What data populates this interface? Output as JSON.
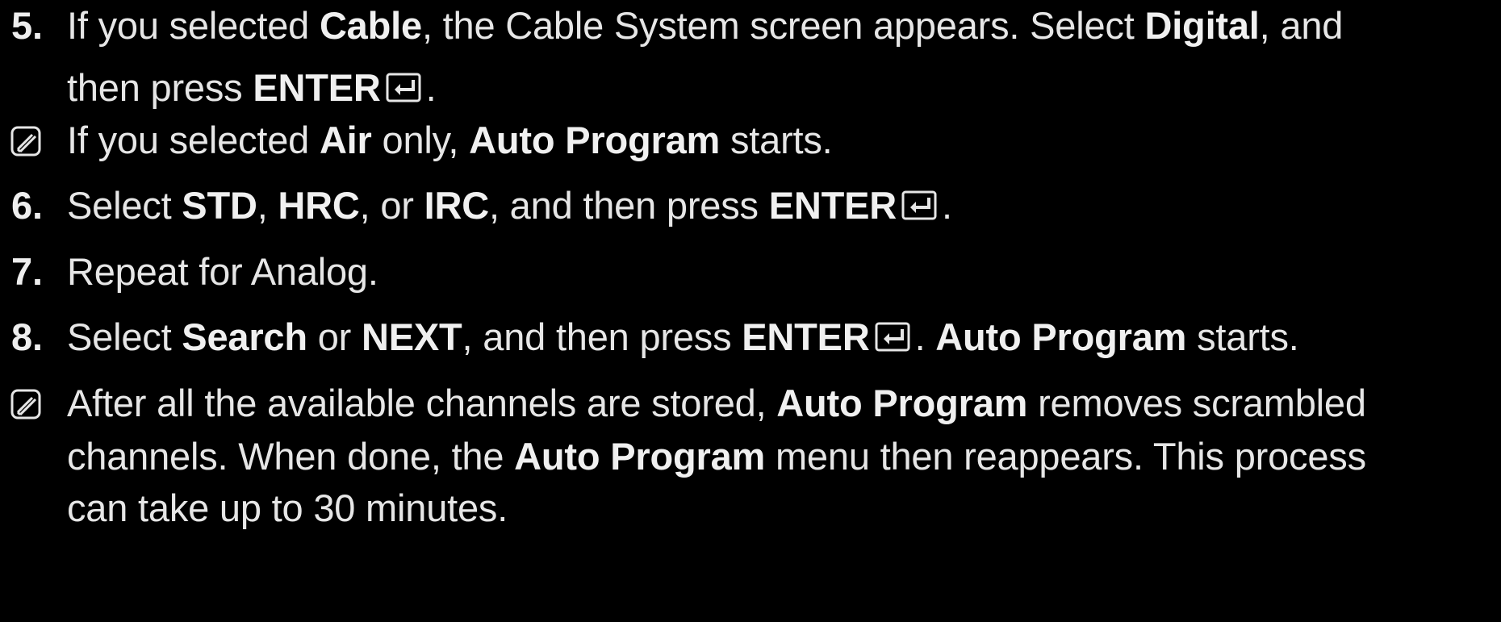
{
  "colors": {
    "background": "#000000",
    "text": "#e6e6e6"
  },
  "icons": {
    "note": "note-icon",
    "enter": "enter-key-icon"
  },
  "items": [
    {
      "type": "step",
      "number": "5.",
      "segments": [
        {
          "text": "If you selected ",
          "bold": false
        },
        {
          "text": "Cable",
          "bold": true
        },
        {
          "text": ", the Cable System screen appears. Select ",
          "bold": false
        },
        {
          "text": "Digital",
          "bold": true
        },
        {
          "text": ", and",
          "bold": false
        }
      ],
      "line2": [
        {
          "text": "then press ",
          "bold": false
        },
        {
          "text": "ENTER",
          "bold": true
        },
        {
          "text": ".",
          "bold": false
        }
      ]
    },
    {
      "type": "note",
      "segments": [
        {
          "text": "If you selected ",
          "bold": false
        },
        {
          "text": "Air",
          "bold": true
        },
        {
          "text": " only, ",
          "bold": false
        },
        {
          "text": "Auto Program",
          "bold": true
        },
        {
          "text": " starts.",
          "bold": false
        }
      ]
    },
    {
      "type": "step",
      "number": "6.",
      "segments": [
        {
          "text": "Select ",
          "bold": false
        },
        {
          "text": "STD",
          "bold": true
        },
        {
          "text": ", ",
          "bold": false
        },
        {
          "text": "HRC",
          "bold": true
        },
        {
          "text": ", or ",
          "bold": false
        },
        {
          "text": "IRC",
          "bold": true
        },
        {
          "text": ", and then press ",
          "bold": false
        },
        {
          "text": "ENTER",
          "bold": true
        },
        {
          "text": ".",
          "bold": false
        }
      ]
    },
    {
      "type": "step",
      "number": "7.",
      "segments": [
        {
          "text": "Repeat for Analog.",
          "bold": false
        }
      ]
    },
    {
      "type": "step",
      "number": "8.",
      "segments": [
        {
          "text": "Select ",
          "bold": false
        },
        {
          "text": "Search",
          "bold": true
        },
        {
          "text": " or ",
          "bold": false
        },
        {
          "text": "NEXT",
          "bold": true
        },
        {
          "text": ", and then press ",
          "bold": false
        },
        {
          "text": "ENTER",
          "bold": true
        },
        {
          "text": ". ",
          "bold": false
        },
        {
          "text": "Auto Program",
          "bold": true
        },
        {
          "text": " starts.",
          "bold": false
        }
      ]
    },
    {
      "type": "note",
      "segments": [
        {
          "text": "After all the available channels are stored, ",
          "bold": false
        },
        {
          "text": "Auto Program",
          "bold": true
        },
        {
          "text": " removes scrambled",
          "bold": false
        }
      ],
      "line2": [
        {
          "text": "channels. When done, the ",
          "bold": false
        },
        {
          "text": "Auto Program",
          "bold": true
        },
        {
          "text": " menu then reappears. This process",
          "bold": false
        }
      ],
      "line3": [
        {
          "text": "can take up to 30 minutes.",
          "bold": false
        }
      ]
    }
  ]
}
